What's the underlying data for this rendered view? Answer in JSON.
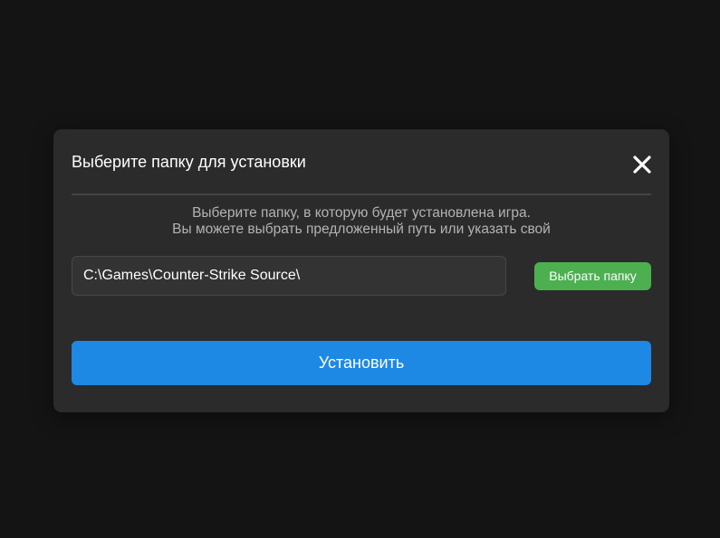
{
  "dialog": {
    "title": "Выберите папку для установки",
    "close_icon": "close-icon",
    "description_line1": "Выберите папку, в которую будет установлена игра.",
    "description_line2": "Вы можете выбрать предложенный путь или указать свой",
    "path_value": "C:\\Games\\Counter-Strike Source\\",
    "browse_label": "Выбрать папку",
    "install_label": "Установить"
  },
  "colors": {
    "page_background": "#141414",
    "dialog_background": "#2b2b2b",
    "browse_button": "#4caf50",
    "install_button": "#1e88e5",
    "description_text": "#b3b3b3"
  }
}
